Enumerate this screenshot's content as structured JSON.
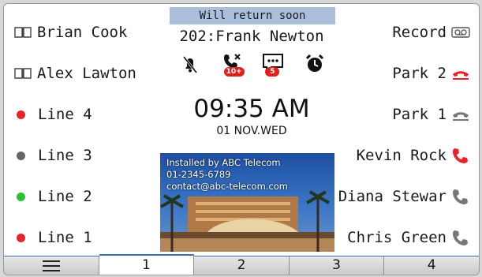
{
  "left_keys": [
    {
      "label": "Brian Cook",
      "icon": "address-book-icon"
    },
    {
      "label": "Alex Lawton",
      "icon": "address-book-icon"
    },
    {
      "label": "Line 4",
      "icon": "status-dot-icon",
      "color": "#e8232a"
    },
    {
      "label": "Line 3",
      "icon": "status-dot-icon",
      "color": "#666666"
    },
    {
      "label": "Line 2",
      "icon": "status-dot-icon",
      "color": "#2bc12e"
    },
    {
      "label": "Line 1",
      "icon": "status-dot-icon",
      "color": "#e8232a"
    }
  ],
  "right_keys": [
    {
      "label": "Record",
      "icon": "voicemail-icon"
    },
    {
      "label": "Park 2",
      "icon": "park-red-icon"
    },
    {
      "label": "Park 1",
      "icon": "park-grey-icon"
    },
    {
      "label": "Kevin Rock",
      "icon": "phone-red-icon"
    },
    {
      "label": "Diana Stewar",
      "icon": "phone-grey-icon"
    },
    {
      "label": "Chris Green",
      "icon": "phone-grey-icon"
    }
  ],
  "status": {
    "banner": "Will return soon",
    "extension": "202:Frank Newton"
  },
  "indicators": [
    {
      "icon": "dnd-bell-icon"
    },
    {
      "icon": "missed-call-icon",
      "badge": "10+"
    },
    {
      "icon": "message-icon",
      "badge": "5"
    },
    {
      "icon": "alarm-clock-icon"
    }
  ],
  "clock": {
    "time": "09:35 AM",
    "date": "01 NOV.WED"
  },
  "ad": {
    "line1": "Installed by ABC Telecom",
    "line2": "01-2345-6789",
    "line3": "contact@abc-telecom.com"
  },
  "tabs": [
    {
      "label": "",
      "icon": "menu-icon"
    },
    {
      "label": "1",
      "active": true
    },
    {
      "label": "2"
    },
    {
      "label": "3"
    },
    {
      "label": "4"
    }
  ],
  "colors": {
    "accent": "#3f6fb0",
    "banner": "#a9bfda",
    "alert": "#e0201b"
  }
}
